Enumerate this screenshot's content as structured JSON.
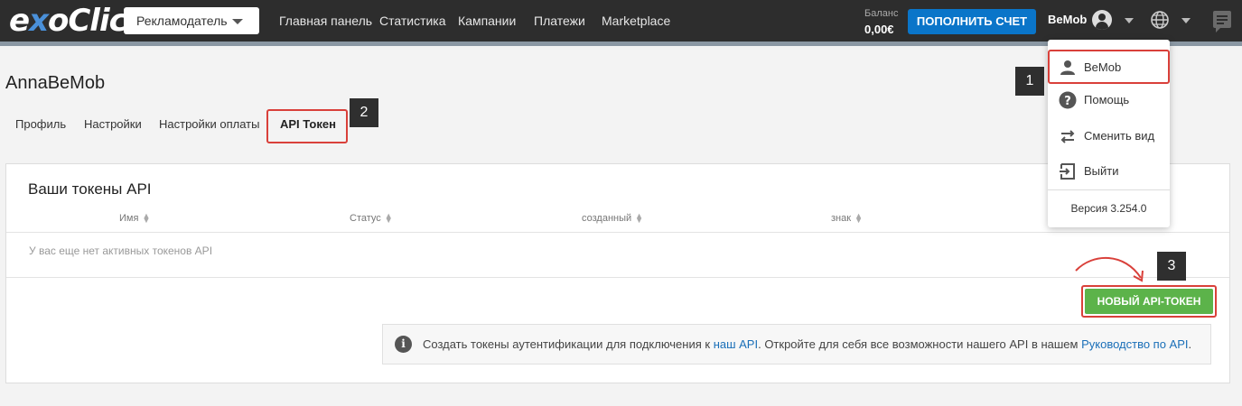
{
  "header": {
    "logo": "exoClick",
    "role_select": "Рекламодатель",
    "nav": [
      "Главная панель",
      "Статистика",
      "Кампании",
      "Платежи",
      "Marketplace"
    ],
    "balance_label": "Баланс",
    "balance_value": "0,00€",
    "topup_label": "ПОПОЛНИТЬ СЧЕТ",
    "user_name": "BeMob",
    "icons": [
      "user-icon",
      "globe-icon",
      "chat-icon"
    ]
  },
  "page": {
    "title": "AnnaBeMob",
    "tabs": [
      "Профиль",
      "Настройки",
      "Настройки оплаты",
      "API Токен"
    ],
    "active_tab": "API Токен"
  },
  "card": {
    "title": "Ваши токены API",
    "columns": [
      "Имя",
      "Статус",
      "созданный",
      "знак"
    ],
    "empty_text": "У вас еще нет активных токенов API",
    "new_token_button": "НОВЫЙ API-ТОКЕН",
    "info": {
      "text_before": "Создать токены аутентификации для подключения к ",
      "link1": "наш API",
      "text_middle": ". Откройте для себя все возможности нашего API в нашем ",
      "link2": "Руководство по API",
      "text_after": "."
    }
  },
  "dropdown": {
    "items": [
      "BeMob",
      "Помощь",
      "Сменить вид",
      "Выйти"
    ],
    "version": "Версия 3.254.0"
  },
  "annotations": {
    "markers": [
      "1",
      "2",
      "3"
    ]
  },
  "colors": {
    "highlight": "#d9403a",
    "primary": "#0a75c9",
    "success": "#5cb34a",
    "topbar": "#2d2d2d"
  }
}
